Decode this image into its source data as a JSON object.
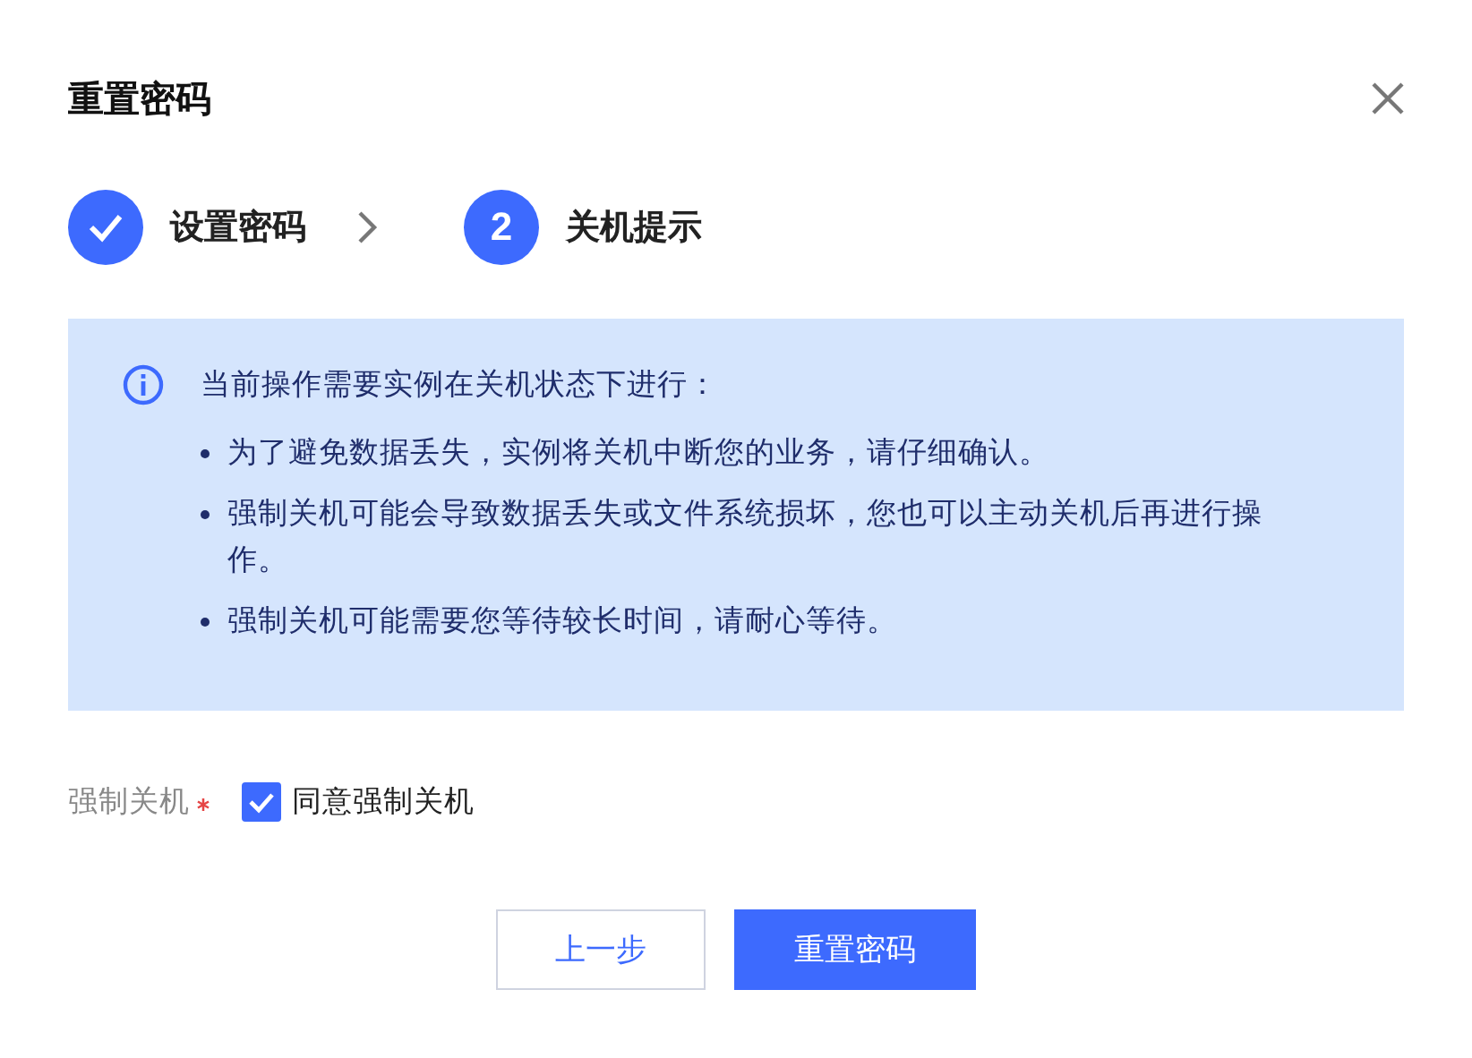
{
  "dialog": {
    "title": "重置密码",
    "steps": [
      {
        "kind": "done",
        "label": "设置密码"
      },
      {
        "kind": "current",
        "number": "2",
        "label": "关机提示"
      }
    ],
    "notice": {
      "heading": "当前操作需要实例在关机状态下进行：",
      "items": [
        "为了避免数据丢失，实例将关机中断您的业务，请仔细确认。",
        "强制关机可能会导致数据丢失或文件系统损坏，您也可以主动关机后再进行操作。",
        "强制关机可能需要您等待较长时间，请耐心等待。"
      ]
    },
    "field": {
      "label": "强制关机",
      "required": true,
      "checkbox": {
        "label": "同意强制关机",
        "checked": true
      }
    },
    "buttons": [
      {
        "kind": "secondary",
        "label": "上一步"
      },
      {
        "kind": "primary",
        "label": "重置密码"
      }
    ]
  }
}
